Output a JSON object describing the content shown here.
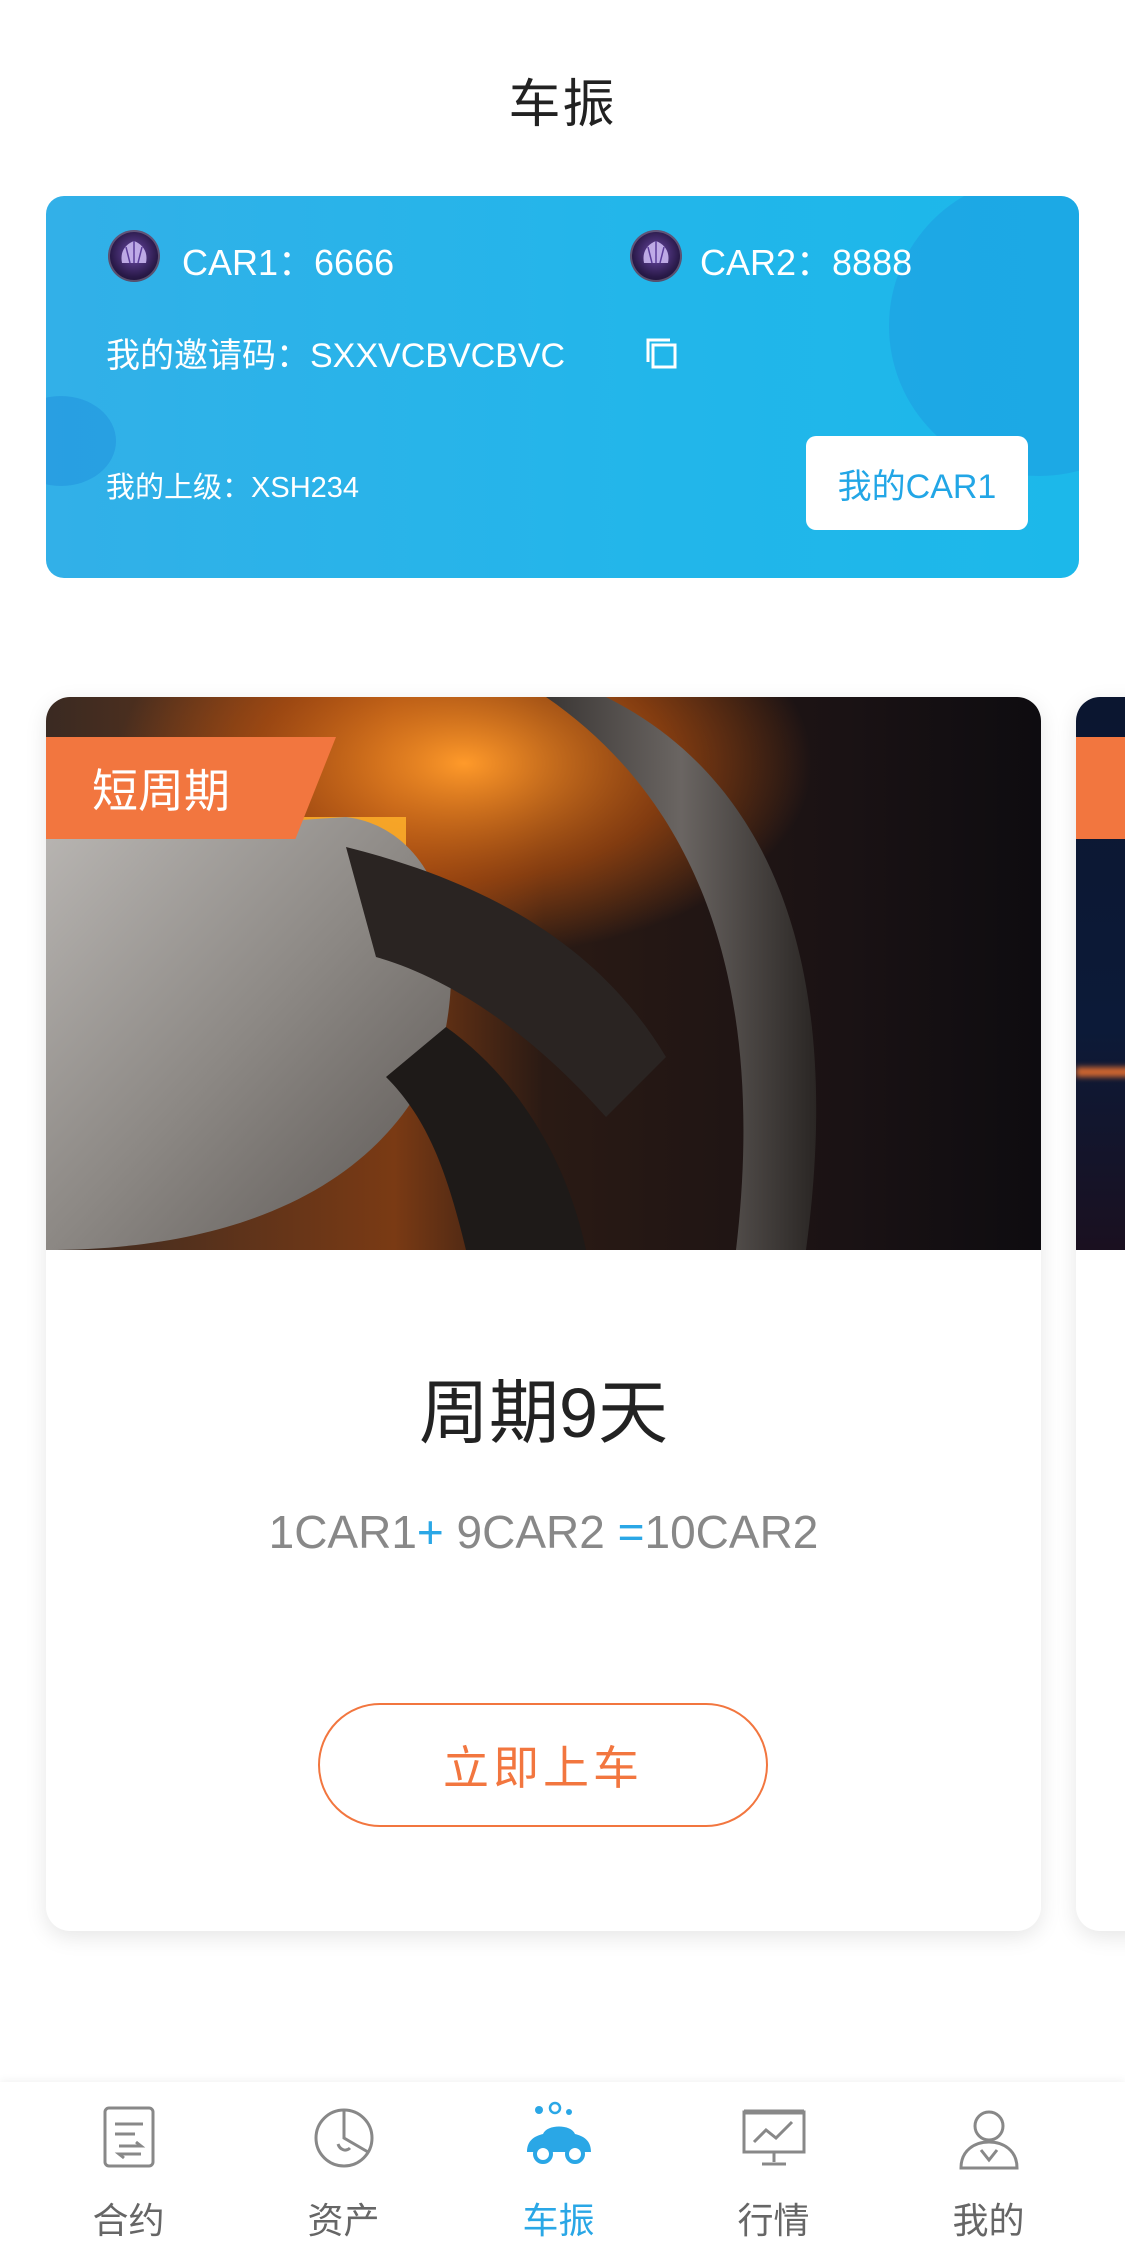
{
  "header": {
    "title": "车振"
  },
  "banner": {
    "car1_label": "CAR1：",
    "car1_value": "6666",
    "car2_label": "CAR2：",
    "car2_value": "8888",
    "invite_label": "我的邀请码：",
    "invite_code": "SXXVCBVCBVC",
    "upline_label": "我的上级：",
    "upline_value": "XSH234",
    "button_label": "我的CAR1"
  },
  "card": {
    "ribbon": "短周期",
    "title": "周期9天",
    "formula": {
      "a": "1CAR1",
      "plus": "+",
      "b": " 9CAR2 ",
      "equals": "=",
      "c": "10CAR2"
    },
    "button_label": "立即上车"
  },
  "tabbar": {
    "items": [
      {
        "label": "合约",
        "icon": "contract-icon",
        "active": false
      },
      {
        "label": "资产",
        "icon": "pie-chart-icon",
        "active": false
      },
      {
        "label": "车振",
        "icon": "car-icon",
        "active": true
      },
      {
        "label": "行情",
        "icon": "market-chart-icon",
        "active": false
      },
      {
        "label": "我的",
        "icon": "user-icon",
        "active": false
      }
    ]
  },
  "colors": {
    "accent": "#2aa7e6",
    "orange": "#f2763f",
    "banner": "#22b6ea"
  }
}
